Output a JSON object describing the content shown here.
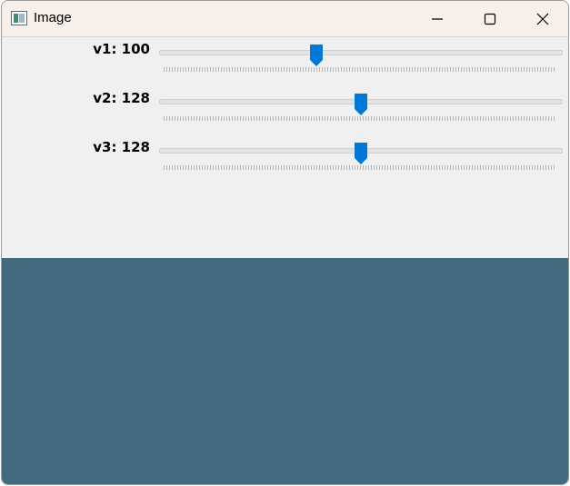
{
  "window": {
    "title": "Image",
    "app_icon": "opencv-window-icon"
  },
  "window_controls": {
    "minimize_icon": "minimize-icon",
    "maximize_icon": "maximize-icon",
    "close_icon": "close-icon"
  },
  "trackbars": [
    {
      "label": "v1: 100",
      "value": 100,
      "max": 255
    },
    {
      "label": "v2: 128",
      "value": 128,
      "max": 255
    },
    {
      "label": "v3: 128",
      "value": 128,
      "max": 255
    }
  ],
  "image": {
    "fill_color": "#426a7f"
  },
  "colors": {
    "thumb": "#0078d7",
    "titlebar": "#f7efea",
    "panel": "#f0f0f0"
  }
}
